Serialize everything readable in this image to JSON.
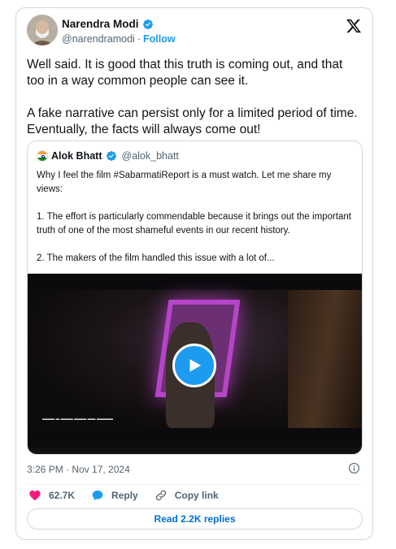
{
  "author": {
    "name": "Narendra Modi",
    "handle": "@narendramodi",
    "separator": "·",
    "follow_label": "Follow"
  },
  "tweet": {
    "paragraphs": [
      "Well said. It is good that this truth is coming out, and that too in a way common people can see it.",
      "A fake narrative can persist only for a limited period of time. Eventually, the facts will always come out!"
    ]
  },
  "quoted": {
    "name": "Alok Bhatt",
    "handle": "@alok_bhatt",
    "paragraphs": [
      "Why I feel the film #SabarmatiReport is a must watch. Let me share my views:",
      "1. The effort is particularly commendable because it brings out the important truth of one of the most shameful events in our recent history.",
      "2. The makers of the film handled this issue with a lot of..."
    ]
  },
  "timestamp": "3:26 PM · Nov 17, 2024",
  "actions": {
    "likes": "62.7K",
    "reply_label": "Reply",
    "copy_link_label": "Copy link"
  },
  "read_replies_label": "Read 2.2K replies",
  "colors": {
    "accent": "#1d9bf0",
    "like": "#f91880",
    "link": "#006fd6"
  },
  "icons": [
    "verified-badge-icon",
    "x-logo-icon",
    "india-flag-icon",
    "play-icon",
    "info-icon",
    "heart-icon",
    "reply-icon",
    "link-icon"
  ]
}
